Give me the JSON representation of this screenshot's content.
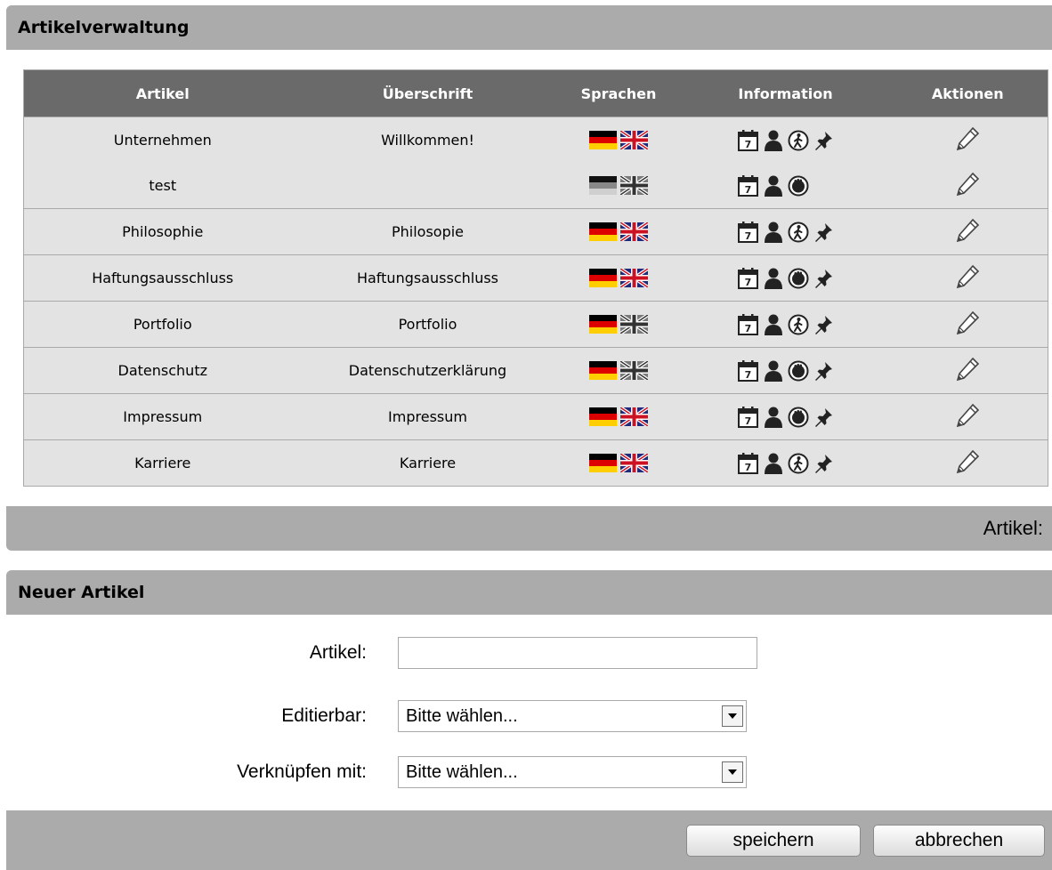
{
  "articles_panel": {
    "title": "Artikelverwaltung",
    "columns": [
      "Artikel",
      "Überschrift",
      "Sprachen",
      "Information",
      "Aktionen"
    ],
    "rows": [
      {
        "article": "Unternehmen",
        "heading": "Willkommen!",
        "de_flag": "active",
        "en_flag": "active",
        "access_icon": "walker-icon",
        "pinned": true
      },
      {
        "article": "test",
        "heading": "",
        "de_flag": "inactive",
        "en_flag": "inactive",
        "access_icon": "hand-stop-icon",
        "pinned": false
      },
      {
        "article": "Philosophie",
        "heading": "Philosopie",
        "de_flag": "active",
        "en_flag": "active",
        "access_icon": "walker-icon",
        "pinned": true
      },
      {
        "article": "Haftungsausschluss",
        "heading": "Haftungsausschluss",
        "de_flag": "active",
        "en_flag": "active",
        "access_icon": "hand-stop-icon",
        "pinned": true
      },
      {
        "article": "Portfolio",
        "heading": "Portfolio",
        "de_flag": "active",
        "en_flag": "inactive",
        "access_icon": "walker-icon",
        "pinned": true
      },
      {
        "article": "Datenschutz",
        "heading": "Datenschutzerklärung",
        "de_flag": "active",
        "en_flag": "inactive",
        "access_icon": "hand-stop-icon",
        "pinned": true
      },
      {
        "article": "Impressum",
        "heading": "Impressum",
        "de_flag": "active",
        "en_flag": "active",
        "access_icon": "hand-stop-icon",
        "pinned": true
      },
      {
        "article": "Karriere",
        "heading": "Karriere",
        "de_flag": "active",
        "en_flag": "active",
        "access_icon": "walker-icon",
        "pinned": true
      }
    ],
    "footer_text": "Artikel:"
  },
  "new_article_panel": {
    "title": "Neuer Artikel",
    "article_label": "Artikel:",
    "article_value": "",
    "editable_label": "Editierbar:",
    "editable_value": "Bitte wählen...",
    "link_label": "Verknüpfen mit:",
    "link_value": "Bitte wählen...",
    "save_label": "speichern",
    "cancel_label": "abbrechen"
  },
  "colors": {
    "panel_bar": "#ababab",
    "table_header": "#6a6a6a",
    "row_bg": "#e3e3e3"
  }
}
